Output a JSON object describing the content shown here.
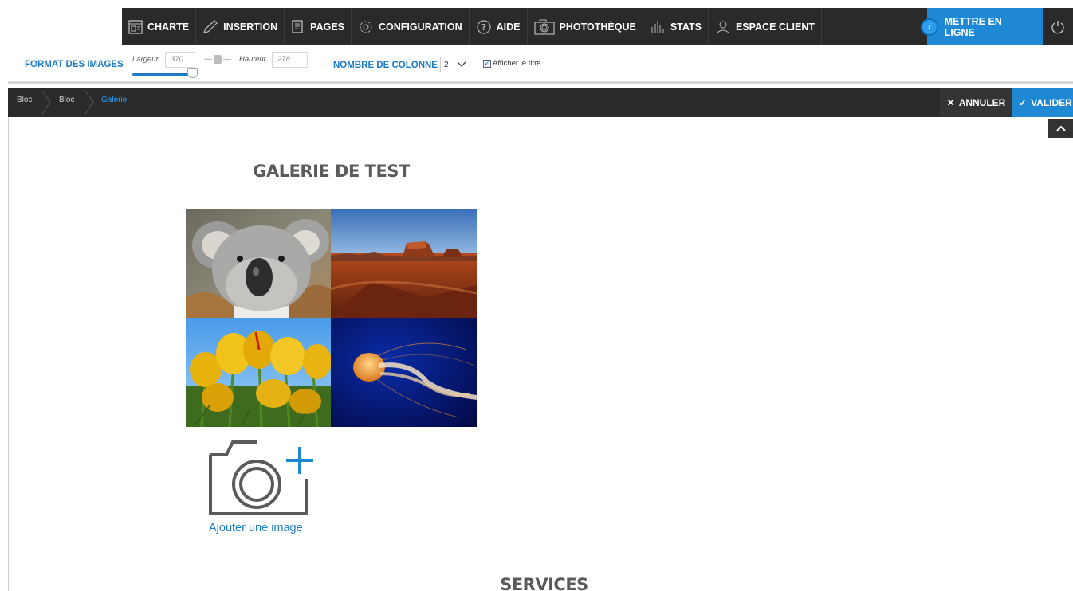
{
  "nav": {
    "items": [
      {
        "label": "CHARTE",
        "icon": "layout-icon"
      },
      {
        "label": "INSERTION",
        "icon": "pencil-icon"
      },
      {
        "label": "PAGES",
        "icon": "pages-icon"
      },
      {
        "label": "CONFIGURATION",
        "icon": "gear-icon"
      },
      {
        "label": "AIDE",
        "icon": "help-icon"
      },
      {
        "label": "PHOTOTHÈQUE",
        "icon": "camera-icon"
      },
      {
        "label": "STATS",
        "icon": "stats-icon"
      },
      {
        "label": "ESPACE CLIENT",
        "icon": "user-icon"
      }
    ],
    "publish_label": "METTRE EN LIGNE"
  },
  "options": {
    "title": "FORMAT DES IMAGES",
    "width_label": "Largeur",
    "width_value": "370",
    "height_label": "Hauteur",
    "height_value": "278",
    "columns_label": "NOMBRE DE COLONNE",
    "columns_value": "2",
    "show_title_label": "Afficher le titre",
    "show_title_checked": true
  },
  "breadcrumb": {
    "items": [
      "Bloc",
      "Bloc",
      "Galerie"
    ],
    "cancel_label": "ANNULER",
    "validate_label": "VALIDER"
  },
  "gallery": {
    "title": "GALERIE DE TEST",
    "images": [
      "koala",
      "desert",
      "tulips",
      "jellyfish"
    ],
    "add_label": "Ajouter une image"
  },
  "next_section": {
    "title": "SERVICES"
  },
  "colors": {
    "accent": "#1e88d4",
    "dark": "#2a2a2a"
  }
}
